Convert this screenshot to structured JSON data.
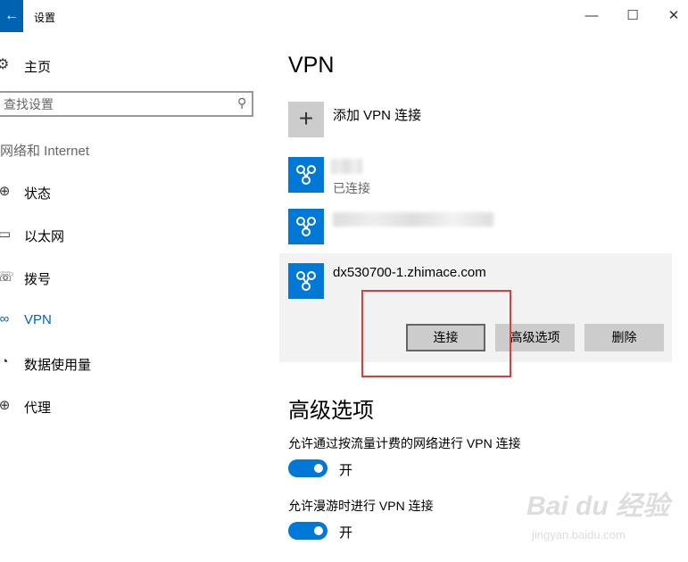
{
  "window": {
    "title": "设置",
    "back_icon": "arrow-left-icon",
    "minimize": "—",
    "maximize": "☐",
    "close": "✕"
  },
  "sidebar": {
    "home": "主页",
    "search_placeholder": "查找设置",
    "section": "网络和 Internet",
    "items": [
      {
        "label": "状态",
        "icon": "globe-icon"
      },
      {
        "label": "以太网",
        "icon": "monitor-icon"
      },
      {
        "label": "拨号",
        "icon": "phone-icon"
      },
      {
        "label": "VPN",
        "icon": "vpn-icon",
        "active": true
      },
      {
        "label": "数据使用量",
        "icon": "data-usage-icon"
      },
      {
        "label": "代理",
        "icon": "globe-icon"
      }
    ]
  },
  "main": {
    "title": "VPN",
    "add_label": "添加 VPN 连接",
    "connections": [
      {
        "name": "",
        "status": "已连接"
      },
      {
        "name": "",
        "status": ""
      },
      {
        "name": "dx530700-1.zhimace.com",
        "status": ""
      }
    ],
    "buttons": {
      "connect": "连接",
      "advanced": "高级选项",
      "delete": "删除"
    },
    "advanced_title": "高级选项",
    "options": [
      {
        "label": "允许通过按流量计费的网络进行 VPN 连接",
        "toggle": "开"
      },
      {
        "label": "允许漫游时进行 VPN 连接",
        "toggle": "开"
      }
    ]
  },
  "colors": {
    "accent": "#0078d7",
    "highlight_box": "#e03a3a"
  },
  "watermark": {
    "brand": "Bai du 经验",
    "url": "jingyan.baidu.com"
  }
}
